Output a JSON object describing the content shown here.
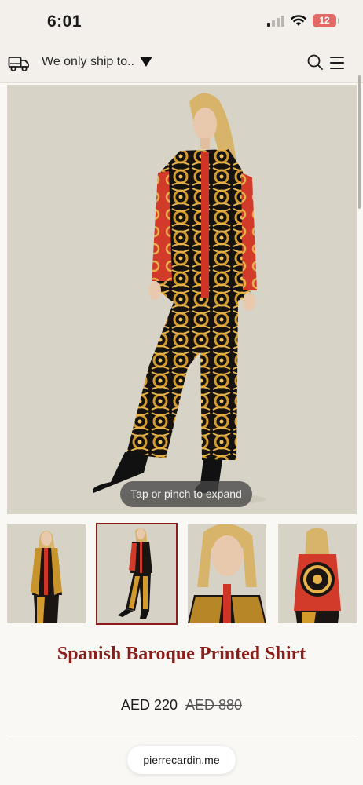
{
  "status_bar": {
    "time": "6:01",
    "battery": "12",
    "icons": [
      "signal-icon",
      "wifi-icon",
      "battery-icon"
    ]
  },
  "header": {
    "shipping_label": "We only ship to..",
    "icons": [
      "truck-icon",
      "dropdown-arrow-icon",
      "search-icon",
      "menu-icon"
    ]
  },
  "gallery": {
    "hint": "Tap or pinch to expand",
    "thumbnail_count": 4,
    "selected_thumbnail": 2
  },
  "product": {
    "title": "Spanish Baroque Printed Shirt",
    "price": "AED 220",
    "original_price": "AED 880"
  },
  "browser": {
    "url": "pierrecardin.me"
  },
  "colors": {
    "brand": "#8a1e1a",
    "background": "#faf8f5",
    "header": "#f3efea",
    "photo_backdrop": "#d8d3c7"
  }
}
